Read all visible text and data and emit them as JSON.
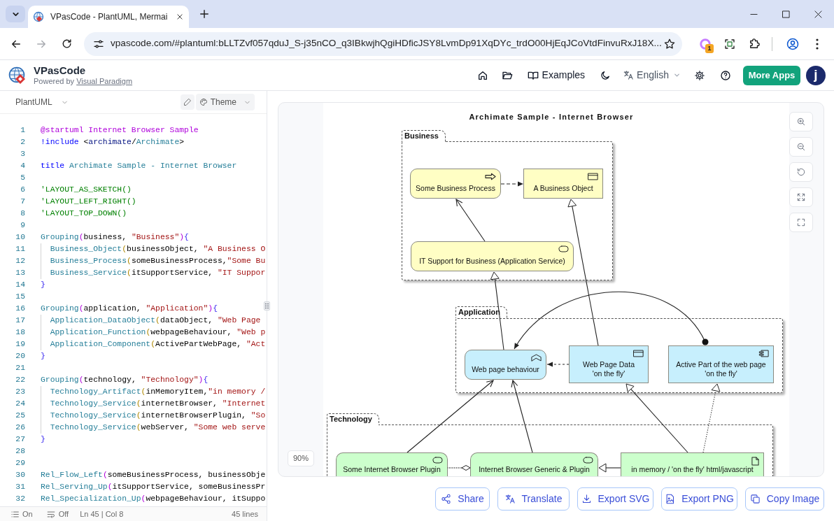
{
  "browser": {
    "tab_title": "VPasCode - PlantUML, Mermai",
    "url": "vpascode.com/#plantuml:bLLTZvf057qduJ_S-j35nCO_q3IBkwjhQgiHDficJSY8LvmDp91XqDYc_trdO00HjEqJCoVtdFinvuRxJ18X...",
    "extension_badge": "1"
  },
  "header": {
    "app_name": "VPasCode",
    "powered_by": "Powered by",
    "powered_by_link": "Visual Paradigm",
    "examples": "Examples",
    "language": "English",
    "more_apps": "More Apps",
    "avatar": "j"
  },
  "editor": {
    "language": "PlantUML",
    "theme": "Theme",
    "lines": [
      {
        "number": "1",
        "indented": false,
        "tokens": [
          {
            "text": "@startuml Internet Browser Sample",
            "kind": "directive"
          }
        ]
      },
      {
        "number": "2",
        "indented": false,
        "tokens": [
          {
            "text": "!include",
            "kind": "keyword"
          },
          {
            "text": " <",
            "kind": "plain"
          },
          {
            "text": "archimate",
            "kind": "variable"
          },
          {
            "text": "/",
            "kind": "plain"
          },
          {
            "text": "Archimate",
            "kind": "function"
          },
          {
            "text": ">",
            "kind": "plain"
          }
        ]
      },
      {
        "number": "3",
        "indented": false
      },
      {
        "number": "4",
        "indented": false,
        "tokens": [
          {
            "text": "title",
            "kind": "keyword"
          },
          {
            "text": " Archimate Sample - Internet Browser",
            "kind": "function"
          }
        ]
      },
      {
        "number": "5",
        "indented": false
      },
      {
        "number": "6",
        "indented": false,
        "tokens": [
          {
            "text": "'LAYOUT_AS_SKETCH()",
            "kind": "comment"
          }
        ]
      },
      {
        "number": "7",
        "indented": false,
        "tokens": [
          {
            "text": "'LAYOUT_LEFT_RIGHT()",
            "kind": "comment"
          }
        ]
      },
      {
        "number": "8",
        "indented": false,
        "tokens": [
          {
            "text": "'LAYOUT_TOP_DOWN()",
            "kind": "comment"
          }
        ]
      },
      {
        "number": "9",
        "indented": false
      },
      {
        "number": "10",
        "indented": false,
        "tokens": [
          {
            "text": "Grouping",
            "kind": "function"
          },
          {
            "text": "(",
            "kind": "bracket"
          },
          {
            "text": "business, ",
            "kind": "plain"
          },
          {
            "text": "\"Business\"",
            "kind": "string"
          },
          {
            "text": ")",
            "kind": "bracket"
          },
          {
            "text": "{",
            "kind": "brace"
          }
        ]
      },
      {
        "number": "11",
        "indented": true,
        "tokens": [
          {
            "text": "Business_Object",
            "kind": "function"
          },
          {
            "text": "(",
            "kind": "bracket2"
          },
          {
            "text": "businessObject, ",
            "kind": "plain"
          },
          {
            "text": "\"A Business O",
            "kind": "string"
          }
        ]
      },
      {
        "number": "12",
        "indented": true,
        "tokens": [
          {
            "text": "Business_Process",
            "kind": "function"
          },
          {
            "text": "(",
            "kind": "bracket2"
          },
          {
            "text": "someBusinessProcess,",
            "kind": "plain"
          },
          {
            "text": "\"Some Bu",
            "kind": "string"
          }
        ]
      },
      {
        "number": "13",
        "indented": true,
        "tokens": [
          {
            "text": "Business_Service",
            "kind": "function"
          },
          {
            "text": "(",
            "kind": "bracket2"
          },
          {
            "text": "itSupportService, ",
            "kind": "plain"
          },
          {
            "text": "\"IT Suppor",
            "kind": "string"
          }
        ]
      },
      {
        "number": "14",
        "indented": false,
        "tokens": [
          {
            "text": "}",
            "kind": "brace"
          }
        ]
      },
      {
        "number": "15",
        "indented": false
      },
      {
        "number": "16",
        "indented": false,
        "tokens": [
          {
            "text": "Grouping",
            "kind": "function"
          },
          {
            "text": "(",
            "kind": "bracket"
          },
          {
            "text": "application, ",
            "kind": "plain"
          },
          {
            "text": "\"Application\"",
            "kind": "string"
          },
          {
            "text": ")",
            "kind": "bracket"
          },
          {
            "text": "{",
            "kind": "brace"
          }
        ]
      },
      {
        "number": "17",
        "indented": true,
        "tokens": [
          {
            "text": "Application_DataObject",
            "kind": "function"
          },
          {
            "text": "(",
            "kind": "bracket2"
          },
          {
            "text": "dataObject, ",
            "kind": "plain"
          },
          {
            "text": "\"Web Page",
            "kind": "string"
          }
        ]
      },
      {
        "number": "18",
        "indented": true,
        "tokens": [
          {
            "text": "Application_Function",
            "kind": "function"
          },
          {
            "text": "(",
            "kind": "bracket2"
          },
          {
            "text": "webpageBehaviour, ",
            "kind": "plain"
          },
          {
            "text": "\"Web p",
            "kind": "string"
          }
        ]
      },
      {
        "number": "19",
        "indented": true,
        "tokens": [
          {
            "text": "Application_Component",
            "kind": "function"
          },
          {
            "text": "(",
            "kind": "bracket2"
          },
          {
            "text": "ActivePartWebPage, ",
            "kind": "plain"
          },
          {
            "text": "\"Act",
            "kind": "string"
          }
        ]
      },
      {
        "number": "20",
        "indented": false,
        "tokens": [
          {
            "text": "}",
            "kind": "brace"
          }
        ]
      },
      {
        "number": "21",
        "indented": false
      },
      {
        "number": "22",
        "indented": false,
        "tokens": [
          {
            "text": "Grouping",
            "kind": "function"
          },
          {
            "text": "(",
            "kind": "bracket"
          },
          {
            "text": "technology, ",
            "kind": "plain"
          },
          {
            "text": "\"Technology\"",
            "kind": "string"
          },
          {
            "text": ")",
            "kind": "bracket"
          },
          {
            "text": "{",
            "kind": "brace"
          }
        ]
      },
      {
        "number": "23",
        "indented": true,
        "tokens": [
          {
            "text": "Technology_Artifact",
            "kind": "function"
          },
          {
            "text": "(",
            "kind": "bracket2"
          },
          {
            "text": "inMemoryItem,",
            "kind": "plain"
          },
          {
            "text": "\"in memory /",
            "kind": "string"
          }
        ]
      },
      {
        "number": "24",
        "indented": true,
        "tokens": [
          {
            "text": "Technology_Service",
            "kind": "function"
          },
          {
            "text": "(",
            "kind": "bracket2"
          },
          {
            "text": "internetBrowser, ",
            "kind": "plain"
          },
          {
            "text": "\"Internet",
            "kind": "string"
          }
        ]
      },
      {
        "number": "25",
        "indented": true,
        "tokens": [
          {
            "text": "Technology_Service",
            "kind": "function"
          },
          {
            "text": "(",
            "kind": "bracket2"
          },
          {
            "text": "internetBrowserPlugin, ",
            "kind": "plain"
          },
          {
            "text": "\"So",
            "kind": "string"
          }
        ]
      },
      {
        "number": "26",
        "indented": true,
        "tokens": [
          {
            "text": "Technology_Service",
            "kind": "function"
          },
          {
            "text": "(",
            "kind": "bracket2"
          },
          {
            "text": "webServer, ",
            "kind": "plain"
          },
          {
            "text": "\"Some web serve",
            "kind": "string"
          }
        ]
      },
      {
        "number": "27",
        "indented": false,
        "tokens": [
          {
            "text": "}",
            "kind": "brace"
          }
        ]
      },
      {
        "number": "28",
        "indented": false
      },
      {
        "number": "29",
        "indented": false
      },
      {
        "number": "30",
        "indented": false,
        "tokens": [
          {
            "text": "Rel_Flow_Left",
            "kind": "function"
          },
          {
            "text": "(",
            "kind": "bracket"
          },
          {
            "text": "someBusinessProcess, businessObje",
            "kind": "plain"
          }
        ]
      },
      {
        "number": "31",
        "indented": false,
        "tokens": [
          {
            "text": "Rel_Serving_Up",
            "kind": "function"
          },
          {
            "text": "(",
            "kind": "bracket"
          },
          {
            "text": "itSupportService, someBusinessPr",
            "kind": "plain"
          }
        ]
      },
      {
        "number": "32",
        "indented": false,
        "tokens": [
          {
            "text": "Rel_Specialization_Up",
            "kind": "function"
          },
          {
            "text": "(",
            "kind": "bracket"
          },
          {
            "text": "webpageBehaviour, itSuppo",
            "kind": "plain"
          }
        ]
      }
    ],
    "status_bar": {
      "outline": "On",
      "wrap": "Off",
      "cursor": "Ln 45 | Col 8",
      "line_count": "45 lines"
    }
  },
  "preview": {
    "zoom": "90%",
    "diagram": {
      "title": "Archimate Sample - Internet Browser",
      "groups": [
        {
          "label": "Business",
          "kind": "business",
          "nodes": [
            {
              "label": "Some Business Process",
              "kind": "process"
            },
            {
              "label": "A Business Object",
              "kind": "object"
            },
            {
              "label": "IT Support for Business (Application Service)",
              "kind": "service"
            }
          ]
        },
        {
          "label": "Application",
          "kind": "application",
          "nodes": [
            {
              "label": "Web page behaviour",
              "kind": "function"
            },
            {
              "label": "Web Page Data\n'on the fly'",
              "kind": "data-object"
            },
            {
              "label": "Active Part of the web page\n'on the fly'",
              "kind": "component"
            }
          ]
        },
        {
          "label": "Technology",
          "kind": "technology",
          "nodes": [
            {
              "label": "Some Internet Browser Plugin",
              "kind": "service"
            },
            {
              "label": "Internet Browser Generic & Plugin",
              "kind": "service"
            },
            {
              "label": "in memory / 'on the fly' html/javascript",
              "kind": "artifact"
            }
          ]
        }
      ],
      "relations": [
        {
          "kind": "flow"
        },
        {
          "kind": "serving"
        },
        {
          "kind": "specialization"
        },
        {
          "kind": "specialization"
        },
        {
          "kind": "access"
        },
        {
          "kind": "assignment"
        },
        {
          "kind": "serving"
        },
        {
          "kind": "serving"
        },
        {
          "kind": "specialization"
        },
        {
          "kind": "realization"
        },
        {
          "kind": "aggregation"
        },
        {
          "kind": "specialization"
        }
      ]
    },
    "actions": [
      {
        "label": "Share"
      },
      {
        "label": "Translate"
      },
      {
        "label": "Export SVG"
      },
      {
        "label": "Export PNG"
      },
      {
        "label": "Copy Image"
      }
    ]
  }
}
